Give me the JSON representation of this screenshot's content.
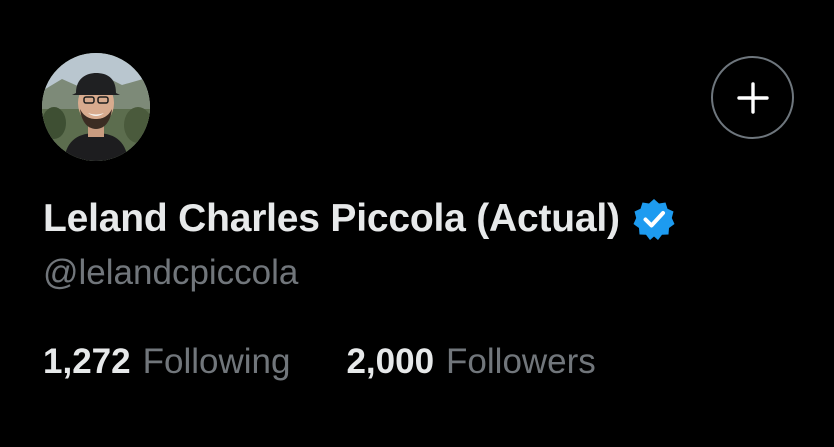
{
  "profile": {
    "display_name": "Leland Charles Piccola (Actual)",
    "handle": "@lelandcpiccola",
    "verified_icon": "verified-badge-icon",
    "avatar_icon": "profile-photo"
  },
  "actions": {
    "add_icon": "plus-icon"
  },
  "stats": {
    "following_count": "1,272",
    "following_label": "Following",
    "followers_count": "2,000",
    "followers_label": "Followers"
  },
  "colors": {
    "background": "#000000",
    "primary_text": "#e7e9ea",
    "secondary_text": "#71767b",
    "verified_blue": "#1d9bf0",
    "button_border": "#6e767d"
  }
}
